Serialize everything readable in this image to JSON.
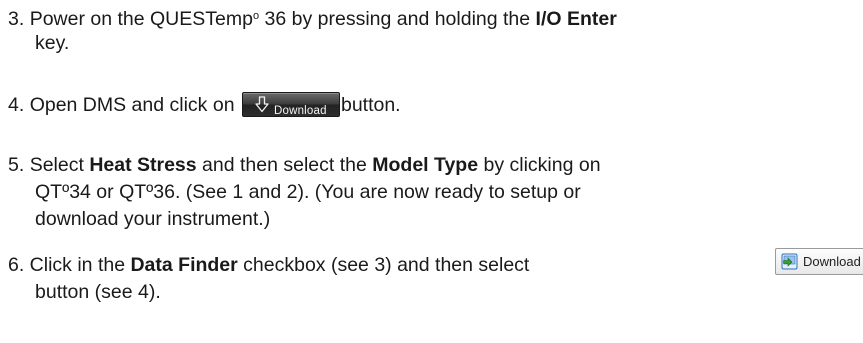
{
  "step3": {
    "num": "3.",
    "text_a": "Power on the QUESTemp",
    "degree": "o",
    "text_b": " 36 by pressing and holding the ",
    "key_bold": "I/O Enter",
    "text_c": "key."
  },
  "step4": {
    "num": "4.",
    "text_a": "Open DMS and click on",
    "button_label": "Download",
    "text_b": "button."
  },
  "step5": {
    "num": "5.",
    "text_a": "Select ",
    "bold_a": "Heat Stress",
    "text_b": " and then select the ",
    "bold_b": "Model Type",
    "text_c": " by clicking on",
    "line2": "QTº34 or QTº36.  (See 1 and 2).    (You are now ready to setup or",
    "line3": "download your instrument.)"
  },
  "step6": {
    "num": "6.",
    "text_a": " Click in the ",
    "bold_a": "Data Finder",
    "text_b": " checkbox (see 3) and then select",
    "button_label": "Download",
    "line2": "button (see 4)."
  },
  "colors": {
    "dark_button": "#2e2e2e",
    "light_button": "#f0f0f0",
    "icon_green": "#3a9a3a",
    "icon_blue": "#2a6fc0"
  },
  "icons": [
    "download-arrow-icon",
    "download-device-icon"
  ]
}
